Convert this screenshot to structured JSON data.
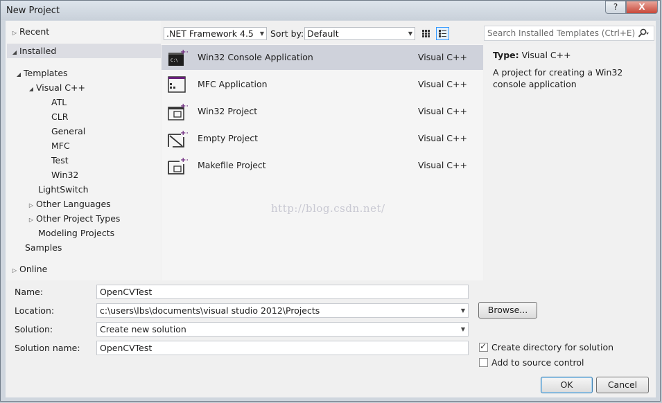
{
  "window": {
    "title": "New Project",
    "help_label": "?",
    "close_label": "X"
  },
  "tree": {
    "recent": "Recent",
    "installed": "Installed",
    "templates": "Templates",
    "visual_cpp": "Visual C++",
    "children": [
      "ATL",
      "CLR",
      "General",
      "MFC",
      "Test",
      "Win32"
    ],
    "lightswitch": "LightSwitch",
    "other_languages": "Other Languages",
    "other_project_types": "Other Project Types",
    "modeling_projects": "Modeling Projects",
    "samples": "Samples",
    "online": "Online"
  },
  "toolbar": {
    "framework": ".NET Framework 4.5",
    "sort_label": "Sort by:",
    "sort_value": "Default"
  },
  "search": {
    "placeholder": "Search Installed Templates (Ctrl+E)"
  },
  "templates": [
    {
      "name": "Win32 Console Application",
      "lang": "Visual C++"
    },
    {
      "name": "MFC Application",
      "lang": "Visual C++"
    },
    {
      "name": "Win32 Project",
      "lang": "Visual C++"
    },
    {
      "name": "Empty Project",
      "lang": "Visual C++"
    },
    {
      "name": "Makefile Project",
      "lang": "Visual C++"
    }
  ],
  "watermark": "http://blog.csdn.net/",
  "info": {
    "type_label": "Type:",
    "type_value": "Visual C++",
    "description": "A project for creating a Win32 console application"
  },
  "form": {
    "name_label": "Name:",
    "name_value": "OpenCVTest",
    "location_label": "Location:",
    "location_value": "c:\\users\\lbs\\documents\\visual studio 2012\\Projects",
    "solution_label": "Solution:",
    "solution_value": "Create new solution",
    "solution_name_label": "Solution name:",
    "solution_name_value": "OpenCVTest",
    "browse_label": "Browse...",
    "create_dir_label": "Create directory for solution",
    "create_dir_checked": true,
    "source_control_label": "Add to source control",
    "source_control_checked": false,
    "ok_label": "OK",
    "cancel_label": "Cancel"
  },
  "colors": {
    "selection": "#cfd2db",
    "accent": "#3399ff",
    "icon_purple": "#68217a"
  }
}
